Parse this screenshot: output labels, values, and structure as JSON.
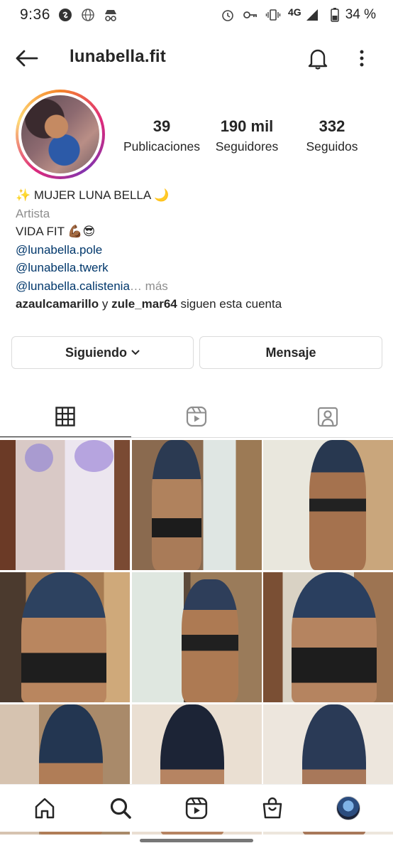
{
  "status_bar": {
    "time": "9:36",
    "network": "4G",
    "battery": "34 %"
  },
  "header": {
    "username": "lunabella.fit"
  },
  "stats": [
    {
      "value": "39",
      "label": "Publicaciones"
    },
    {
      "value": "190 mil",
      "label": "Seguidores"
    },
    {
      "value": "332",
      "label": "Seguidos"
    }
  ],
  "bio": {
    "name": "✨ MUJER LUNA BELLA 🌙",
    "category": "Artista",
    "line1": "VIDA FIT 💪🏾😎",
    "links": [
      "@lunabella.pole",
      "@lunabella.twerk",
      "@lunabella.calistenia"
    ],
    "more_ellipsis": "… ",
    "more": "más",
    "followed_by_user1": "azaulcamarillo",
    "followed_by_sep": " y ",
    "followed_by_user2": "zule_mar64",
    "followed_by_suffix": " siguen esta cuenta"
  },
  "buttons": {
    "following": "Siguiendo",
    "message": "Mensaje"
  },
  "colors": {
    "text": "#262626",
    "secondary": "#8e8e8e",
    "link": "#00376b",
    "border": "#dbdbdb"
  },
  "icons": {
    "tabs": [
      "grid-icon",
      "reels-icon",
      "tagged-icon"
    ],
    "nav": [
      "home-icon",
      "search-icon",
      "reels-icon",
      "shop-icon",
      "profile-avatar"
    ]
  }
}
